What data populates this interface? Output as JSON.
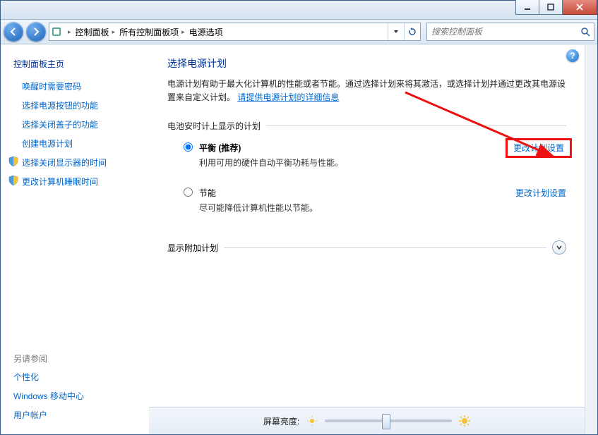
{
  "titlebar": {
    "app_hint": ""
  },
  "nav": {
    "breadcrumbs": [
      "控制面板",
      "所有控制面板项",
      "电源选项"
    ],
    "search_placeholder": "搜索控制面板"
  },
  "sidebar": {
    "home": "控制面板主页",
    "links": [
      "唤醒时需要密码",
      "选择电源按钮的功能",
      "选择关闭盖子的功能",
      "创建电源计划",
      "选择关闭显示器的时间",
      "更改计算机睡眠时间"
    ],
    "see_also_title": "另请参阅",
    "see_also": [
      "个性化",
      "Windows 移动中心",
      "用户帐户"
    ]
  },
  "main": {
    "heading": "选择电源计划",
    "desc_prefix": "电源计划有助于最大化计算机的性能或者节能。通过选择计划来将其激活，或选择计划并通过更改其电源设置来自定义计划。",
    "desc_link": "请提供电源计划的详细信息",
    "section_battery": "电池安时计上显示的计划",
    "plans": [
      {
        "name": "平衡 (推荐)",
        "desc": "利用可用的硬件自动平衡功耗与性能。",
        "change": "更改计划设置",
        "checked": true
      },
      {
        "name": "节能",
        "desc": "尽可能降低计算机性能以节能。",
        "change": "更改计划设置",
        "checked": false
      }
    ],
    "section_more": "显示附加计划",
    "brightness_label": "屏幕亮度:"
  }
}
